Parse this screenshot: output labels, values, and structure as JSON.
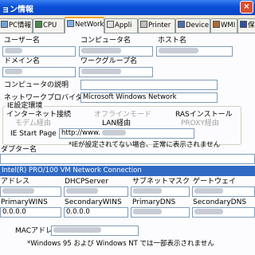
{
  "window": {
    "title": "ョン情報",
    "close_glyph": "×"
  },
  "tabs": [
    {
      "label": "PC情報"
    },
    {
      "label": "CPU"
    },
    {
      "label": "NetWork"
    },
    {
      "label": "Appli"
    },
    {
      "label": "Printer"
    },
    {
      "label": "Device"
    },
    {
      "label": "WMI"
    },
    {
      "label": "保"
    }
  ],
  "network": {
    "user_name_label": "ユーザー名",
    "computer_name_label": "コンピュータ名",
    "host_name_label": "ホスト名",
    "domain_name_label": "ドメイン名",
    "workgroup_name_label": "ワークグループ名",
    "computer_desc_label": "コンピュータの説明",
    "provider_label": "ネットワークプロバイダ名",
    "provider_value": "Microsoft Windows Network"
  },
  "ie": {
    "group_title": "IE設定環境",
    "internet_connection": "インターネット接続",
    "offline_mode": "オフラインモード",
    "ras_install": "RASインストール",
    "via_modem": "モデム経由",
    "via_lan": "LAN経由",
    "via_proxy": "PROXY経由",
    "start_page_label": "IE Start Page",
    "start_page_value": "http://www.",
    "note": "*IEが設定されてない場合、正常に表示されません"
  },
  "adapter": {
    "label": "ダプター名",
    "selected": "Intel(R) PRO/100 VM Network Connection",
    "ip_label": "アドレス",
    "dhcp_label": "DHCPServer",
    "subnet_label": "サブネットマスク",
    "gateway_label": "ゲートウェイ",
    "primary_wins_label": "PrimaryWINS",
    "secondary_wins_label": "SecondaryWINS",
    "primary_dns_label": "PrimaryDNS",
    "secondary_dns_label": "SecondaryDNS",
    "primary_wins_value": "0.0.0.0",
    "secondary_wins_value": "0.0.0.0",
    "mac_label": "MACアドレス",
    "footnote": "*Windows 95 および Windows NT では一部表示されません"
  }
}
